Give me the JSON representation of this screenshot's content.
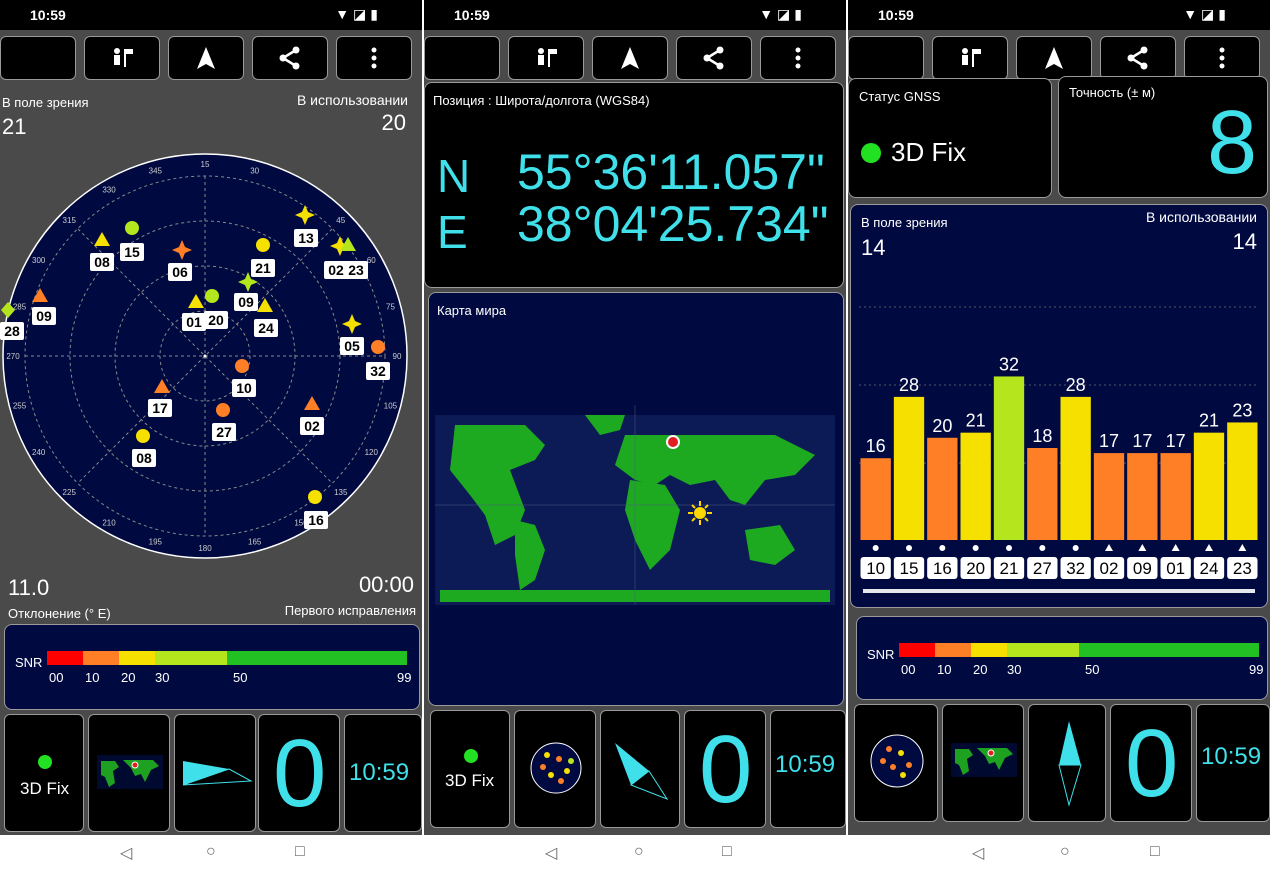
{
  "status_bar": {
    "time": "10:59",
    "icons": "▼◪▮"
  },
  "screen1": {
    "in_view_label": "В поле зрения",
    "in_view_value": "21",
    "in_use_label": "В использовании",
    "in_use_value": "20",
    "declination_value": "11.0",
    "declination_label": "Отклонение (° E)",
    "first_fix_value": "00:00",
    "first_fix_label": "Первого исправления",
    "sky_ticks": [
      "45",
      "60",
      "75",
      "90",
      "105",
      "120",
      "135",
      "150",
      "165",
      "180",
      "195",
      "210",
      "225",
      "240",
      "255",
      "270",
      "285",
      "300",
      "315",
      "330",
      "345",
      "15",
      "30"
    ],
    "satellites": [
      {
        "id": "08",
        "shape": "triangle",
        "color": "#f5e000"
      },
      {
        "id": "15",
        "shape": "circle",
        "color": "#b5e61d"
      },
      {
        "id": "06",
        "shape": "star",
        "color": "#ff7f27"
      },
      {
        "id": "21",
        "shape": "circle",
        "color": "#f5e000"
      },
      {
        "id": "13",
        "shape": "star",
        "color": "#f5e000"
      },
      {
        "id": "02",
        "shape": "star",
        "color": "#f5e000"
      },
      {
        "id": "23",
        "shape": "triangle",
        "color": "#b5e61d"
      },
      {
        "id": "09",
        "shape": "triangle",
        "color": "#ff7f27"
      },
      {
        "id": "28",
        "shape": "diamond",
        "color": "#b5e61d"
      },
      {
        "id": "01",
        "shape": "triangle",
        "color": "#f5e000"
      },
      {
        "id": "20",
        "shape": "circle",
        "color": "#b5e61d"
      },
      {
        "id": "09",
        "shape": "star",
        "color": "#b5e61d"
      },
      {
        "id": "24",
        "shape": "triangle",
        "color": "#f5e000"
      },
      {
        "id": "05",
        "shape": "star",
        "color": "#f5e000"
      },
      {
        "id": "32",
        "shape": "circle",
        "color": "#ff7f27"
      },
      {
        "id": "10",
        "shape": "circle",
        "color": "#ff7f27"
      },
      {
        "id": "17",
        "shape": "triangle",
        "color": "#ff7f27"
      },
      {
        "id": "27",
        "shape": "circle",
        "color": "#ff7f27"
      },
      {
        "id": "02",
        "shape": "triangle",
        "color": "#ff7f27"
      },
      {
        "id": "08",
        "shape": "circle",
        "color": "#f5e000"
      },
      {
        "id": "16",
        "shape": "circle",
        "color": "#f5e000"
      }
    ]
  },
  "snr_legend": {
    "label": "SNR",
    "ticks": [
      "00",
      "10",
      "20",
      "30",
      "50",
      "99"
    ],
    "colors": [
      "#ff0000",
      "#ff7f27",
      "#f5e000",
      "#b5e61d",
      "#22c022"
    ]
  },
  "screen2": {
    "position_title": "Позиция : Широта/долгота (WGS84)",
    "lat_hem": "N",
    "lat": "55°36'11.057\"",
    "lon_hem": "E",
    "lon": "38°04'25.734\"",
    "map_title": "Карта мира"
  },
  "screen3": {
    "gnss_status_label": "Статус GNSS",
    "fix_text": "3D Fix",
    "accuracy_label": "Точность (± м)",
    "accuracy_value": "8",
    "in_view_label": "В поле зрения",
    "in_view_value": "14",
    "in_use_label": "В использовании",
    "in_use_value": "14"
  },
  "chart_data": {
    "type": "bar",
    "categories": [
      "10",
      "15",
      "16",
      "20",
      "21",
      "27",
      "32",
      "02",
      "09",
      "01",
      "24",
      "23"
    ],
    "values": [
      16,
      28,
      20,
      21,
      32,
      18,
      28,
      17,
      17,
      17,
      21,
      23
    ],
    "colors": [
      "#ff7f27",
      "#f5e000",
      "#ff7f27",
      "#f5e000",
      "#b5e61d",
      "#ff7f27",
      "#f5e000",
      "#ff7f27",
      "#ff7f27",
      "#ff7f27",
      "#f5e000",
      "#f5e000"
    ],
    "markers": [
      "circle",
      "circle",
      "circle",
      "circle",
      "circle",
      "circle",
      "circle",
      "triangle",
      "triangle",
      "triangle",
      "triangle",
      "triangle"
    ],
    "ylim": [
      0,
      45
    ]
  },
  "bottom": {
    "fix_label": "3D Fix",
    "big_zero": "0",
    "clock": "10:59"
  }
}
